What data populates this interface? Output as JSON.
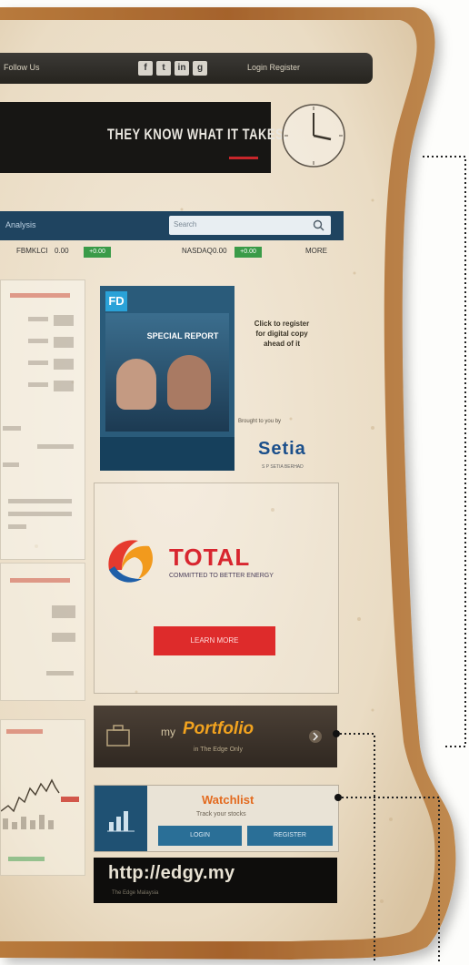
{
  "banner": {
    "slogan": "THEY KNOW WHAT IT TAKES."
  },
  "topbar": {
    "left_text": "Follow Us",
    "right_text": "Login Register",
    "social": [
      "f",
      "t",
      "in",
      "g"
    ]
  },
  "nav": {
    "label": "Analysis",
    "search_placeholder": "Search"
  },
  "tickers": [
    {
      "name": "FBMKLCI",
      "value": "0.00",
      "change": "+0.00"
    },
    {
      "name": "NASDAQ",
      "value": "0.00",
      "change": "+0.00"
    },
    {
      "name": "MORE"
    }
  ],
  "fd_ad": {
    "logo": "FD",
    "headline": "SPECIAL REPORT"
  },
  "click_text": "Click to register for digital copy ahead of it",
  "sponsored": "Brought to you by",
  "setia": {
    "brand": "Setia",
    "sub": "S P SETIA BERHAD"
  },
  "total": {
    "brand": "TOTAL",
    "tagline": "COMMITTED TO BETTER ENERGY",
    "cta": "LEARN MORE"
  },
  "portfolio": {
    "my": "my",
    "word": "Portfolio",
    "sub": "in The Edge Only"
  },
  "watchlist": {
    "title": "Watchlist",
    "sub": "Track your stocks",
    "btn1": "LOGIN",
    "btn2": "REGISTER"
  },
  "edgy": {
    "url": "http://edgy.my",
    "sub": "The Edge Malaysia"
  },
  "colors": {
    "navy": "#1f4460",
    "red": "#de2b2b",
    "orange": "#f2a31f",
    "green": "#3a9b48"
  }
}
